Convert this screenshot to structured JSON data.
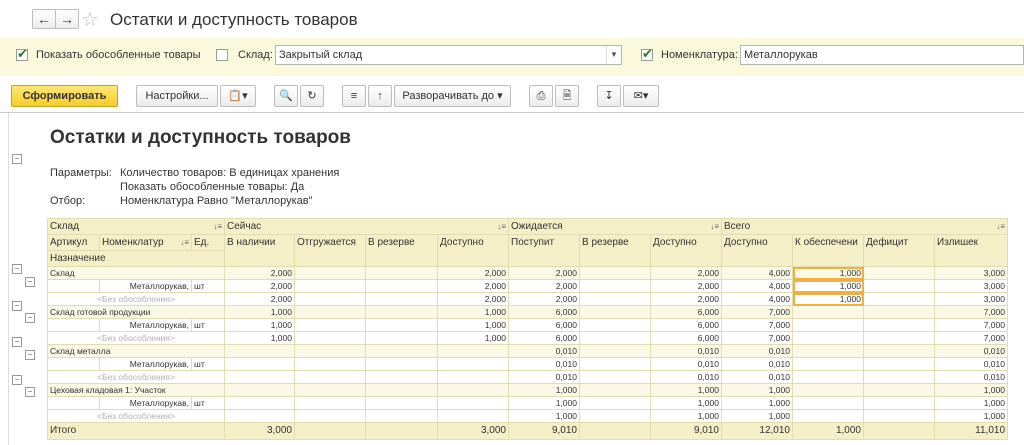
{
  "window": {
    "title": "Остатки и доступность товаров"
  },
  "filters": {
    "show_separate_label": "Показать обособленные товары",
    "warehouse_label": "Склад:",
    "warehouse_value": "Закрытый склад",
    "nomenclature_label": "Номенклатура:",
    "nomenclature_value": "Металлорукав"
  },
  "toolbar": {
    "form_label": "Сформировать",
    "settings_label": "Настройки...",
    "expand_label": "Разворачивать до"
  },
  "report": {
    "title": "Остатки и доступность товаров",
    "params_label": "Параметры:",
    "param1": "Количество товаров: В единицах хранения",
    "param2": "Показать обособленные товары: Да",
    "filter_label": "Отбор:",
    "filter_value": "Номенклатура Равно \"Металлорукав\""
  },
  "table": {
    "h_sklad": "Склад",
    "h_now": "Сейчас",
    "h_expected": "Ожидается",
    "h_total": "Всего",
    "h_article": "Артикул",
    "h_nomen": "Номенклатур",
    "h_unit": "Ед.",
    "h_purpose": "Назначение",
    "h_in_stock": "В наличии",
    "h_shipping": "Отгружается",
    "h_reserve": "В резерве",
    "h_available": "Доступно",
    "h_incoming": "Поступит",
    "h_reserve2": "В резерве",
    "h_available2": "Доступно",
    "h_available3": "Доступно",
    "h_to_provide": "К обеспечени",
    "h_deficit": "Дефицит",
    "h_surplus": "Излишек",
    "rows": [
      {
        "name": "Склад",
        "unit": "",
        "c": [
          "2,000",
          "",
          "",
          "2,000",
          "2,000",
          "",
          "2,000",
          "4,000",
          "1,000",
          "",
          "3,000"
        ]
      },
      {
        "name": "Металлорукав,",
        "unit": "шт",
        "c": [
          "2,000",
          "",
          "",
          "2,000",
          "2,000",
          "",
          "2,000",
          "4,000",
          "1,000",
          "",
          "3,000"
        ]
      },
      {
        "name": "<Без обособления>",
        "unit": "",
        "c": [
          "2,000",
          "",
          "",
          "2,000",
          "2,000",
          "",
          "2,000",
          "4,000",
          "1,000",
          "",
          "3,000"
        ]
      },
      {
        "name": "Склад готовой продукции",
        "unit": "",
        "c": [
          "1,000",
          "",
          "",
          "1,000",
          "6,000",
          "",
          "6,000",
          "7,000",
          "",
          "",
          "7,000"
        ]
      },
      {
        "name": "Металлорукав,",
        "unit": "шт",
        "c": [
          "1,000",
          "",
          "",
          "1,000",
          "6,000",
          "",
          "6,000",
          "7,000",
          "",
          "",
          "7,000"
        ]
      },
      {
        "name": "<Без обособления>",
        "unit": "",
        "c": [
          "1,000",
          "",
          "",
          "1,000",
          "6,000",
          "",
          "6,000",
          "7,000",
          "",
          "",
          "7,000"
        ]
      },
      {
        "name": "Склад металла",
        "unit": "",
        "c": [
          "",
          "",
          "",
          "",
          "0,010",
          "",
          "0,010",
          "0,010",
          "",
          "",
          "0,010"
        ]
      },
      {
        "name": "Металлорукав,",
        "unit": "шт",
        "c": [
          "",
          "",
          "",
          "",
          "0,010",
          "",
          "0,010",
          "0,010",
          "",
          "",
          "0,010"
        ]
      },
      {
        "name": "<Без обособления>",
        "unit": "",
        "c": [
          "",
          "",
          "",
          "",
          "0,010",
          "",
          "0,010",
          "0,010",
          "",
          "",
          "0,010"
        ]
      },
      {
        "name": "Цеховая кладовая 1: Участок",
        "unit": "",
        "c": [
          "",
          "",
          "",
          "",
          "1,000",
          "",
          "1,000",
          "1,000",
          "",
          "",
          "1,000"
        ]
      },
      {
        "name": "Металлорукав,",
        "unit": "шт",
        "c": [
          "",
          "",
          "",
          "",
          "1,000",
          "",
          "1,000",
          "1,000",
          "",
          "",
          "1,000"
        ]
      },
      {
        "name": "<Без обособления>",
        "unit": "",
        "c": [
          "",
          "",
          "",
          "",
          "1,000",
          "",
          "1,000",
          "1,000",
          "",
          "",
          "1,000"
        ]
      }
    ],
    "total": {
      "label": "Итого",
      "c": [
        "3,000",
        "",
        "",
        "3,000",
        "9,010",
        "",
        "9,010",
        "12,010",
        "1,000",
        "",
        "11,010"
      ]
    }
  }
}
